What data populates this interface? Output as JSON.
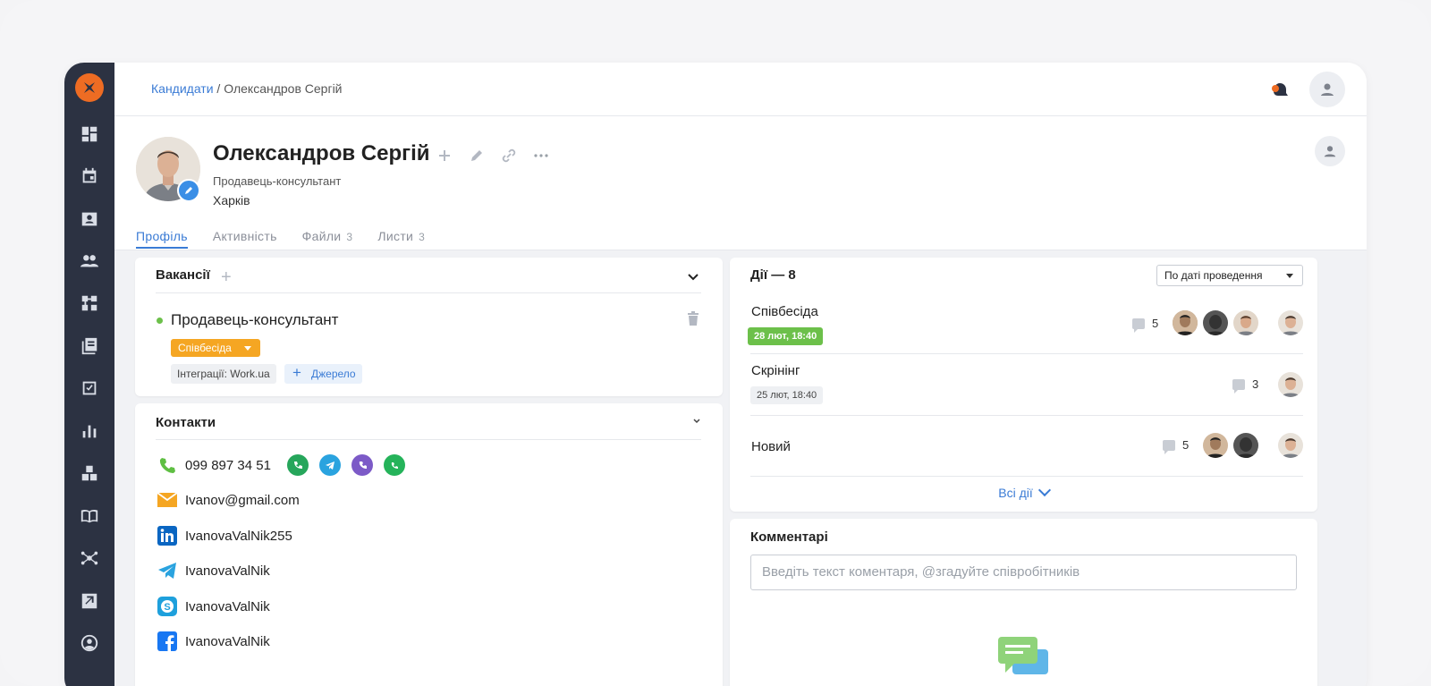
{
  "breadcrumb": {
    "root": "Кандидати",
    "separator": " / ",
    "current": "Олександров Сергій"
  },
  "candidate": {
    "name": "Олександров Сергій",
    "position": "Продавець-консультант",
    "city": "Харків"
  },
  "tabs": [
    {
      "label": "Профіль",
      "count": ""
    },
    {
      "label": "Активність",
      "count": ""
    },
    {
      "label": "Файли",
      "count": "3"
    },
    {
      "label": "Листи",
      "count": "3"
    }
  ],
  "vacancies": {
    "title": "Вакансії",
    "item": {
      "name": "Продавець-консультант",
      "status": "Співбесіда",
      "integration_tag": "Інтеграції: Work.ua",
      "source_label": "Джерело"
    }
  },
  "contacts": {
    "title": "Контакти",
    "phone": "099 897 34 51",
    "email": "Ivanov@gmail.com",
    "linkedin": "IvanovaValNik255",
    "telegram": "IvanovaValNik",
    "skype": "IvanovaValNik",
    "facebook": "IvanovaValNik"
  },
  "actions": {
    "title": "Дії — 8",
    "sort": "По даті проведення",
    "items": [
      {
        "name": "Співбесіда",
        "date": "28 лют, 18:40",
        "comments": "5"
      },
      {
        "name": "Скрінінг",
        "date": "25 лют, 18:40",
        "comments": "3"
      },
      {
        "name": "Новий",
        "date": "",
        "comments": "5"
      }
    ],
    "all_label": "Всі дії"
  },
  "comments_section": {
    "title": "Комментарі",
    "placeholder": "Введіть текст коментаря, @згадуйте співробітників"
  },
  "colors": {
    "sidebar": "#2c3242",
    "accent": "#3a7bd5",
    "logo": "#ee6c23",
    "status_orange": "#f5a623",
    "status_green": "#6cc04a"
  }
}
